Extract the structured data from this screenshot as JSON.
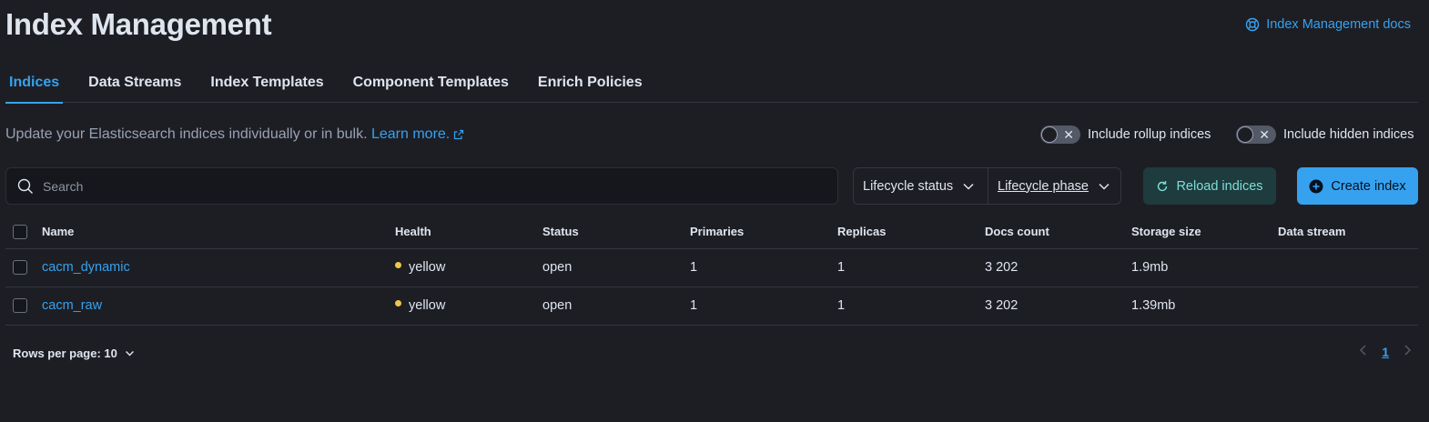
{
  "header": {
    "title": "Index Management",
    "docs_link": "Index Management docs"
  },
  "tabs": [
    {
      "label": "Indices",
      "active": true
    },
    {
      "label": "Data Streams",
      "active": false
    },
    {
      "label": "Index Templates",
      "active": false
    },
    {
      "label": "Component Templates",
      "active": false
    },
    {
      "label": "Enrich Policies",
      "active": false
    }
  ],
  "description": {
    "text": "Update your Elasticsearch indices individually or in bulk.",
    "learn_more": "Learn more."
  },
  "toggles": {
    "rollup": {
      "label": "Include rollup indices",
      "on": false
    },
    "hidden": {
      "label": "Include hidden indices",
      "on": false
    }
  },
  "search": {
    "placeholder": "Search",
    "value": ""
  },
  "filters": {
    "lifecycle_status": "Lifecycle status",
    "lifecycle_phase": "Lifecycle phase"
  },
  "actions": {
    "reload": "Reload indices",
    "create": "Create index"
  },
  "table": {
    "columns": [
      "Name",
      "Health",
      "Status",
      "Primaries",
      "Replicas",
      "Docs count",
      "Storage size",
      "Data stream"
    ],
    "rows": [
      {
        "name": "cacm_dynamic",
        "health": "yellow",
        "status": "open",
        "primaries": "1",
        "replicas": "1",
        "docs_count": "3 202",
        "storage_size": "1.9mb",
        "data_stream": ""
      },
      {
        "name": "cacm_raw",
        "health": "yellow",
        "status": "open",
        "primaries": "1",
        "replicas": "1",
        "docs_count": "3 202",
        "storage_size": "1.39mb",
        "data_stream": ""
      }
    ]
  },
  "pagination": {
    "rows_per_page": "Rows per page: 10",
    "current_page": "1"
  },
  "colors": {
    "background": "#1d1e24",
    "accent": "#36a2ef",
    "health_yellow": "#f0c54a"
  }
}
